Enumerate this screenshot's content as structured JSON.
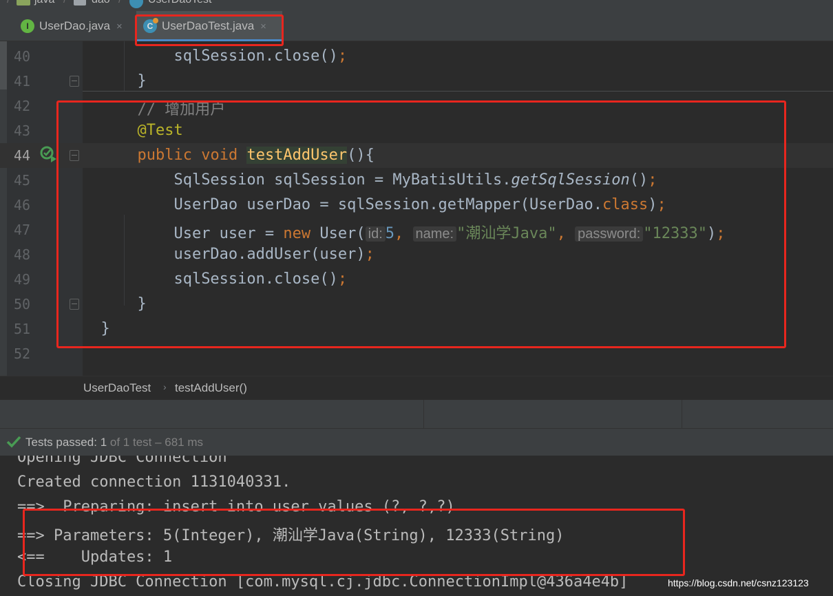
{
  "breadcrumb_top": {
    "items": [
      "java",
      "dao",
      "UserDaoTest"
    ]
  },
  "tabs": [
    {
      "label": "UserDao.java",
      "icon": "interface-icon",
      "active": false
    },
    {
      "label": "UserDaoTest.java",
      "icon": "class-icon",
      "active": true
    }
  ],
  "close_glyph": "×",
  "editor": {
    "line_numbers": [
      "40",
      "41",
      "42",
      "43",
      "44",
      "45",
      "46",
      "47",
      "48",
      "49",
      "50",
      "51",
      "52"
    ],
    "current_line": "44",
    "code": {
      "l40": {
        "text1": "sqlSession.close()",
        "semi": ";"
      },
      "l41": {
        "text": "}"
      },
      "l42": {
        "comment": "// 增加用户"
      },
      "l43": {
        "annotation": "@Test"
      },
      "l44": {
        "kw1": "public",
        "kw2": "void",
        "method": "testAddUser",
        "rest": "(){"
      },
      "l45": {
        "a": "SqlSession sqlSession = MyBatisUtils.",
        "call": "getSqlSession",
        "b": "()",
        "semi": ";"
      },
      "l46": {
        "a": "UserDao userDao = sqlSession.getMapper(UserDao.",
        "kw": "class",
        "b": ")",
        "semi": ";"
      },
      "l47": {
        "a": "User user = ",
        "kw": "new",
        "b": " User(",
        "hint1": "id:",
        "num": "5",
        "c1": ", ",
        "hint2": "name:",
        "str1": "\"潮汕学Java\"",
        "c2": ", ",
        "hint3": "password:",
        "str2": "\"12333\"",
        "d": ")",
        "semi": ";"
      },
      "l48": {
        "a": "userDao.addUser(user)",
        "semi": ";"
      },
      "l49": {
        "a": "sqlSession.close()",
        "semi": ";"
      },
      "l50": {
        "text": "}"
      },
      "l51": {
        "text": "}"
      }
    }
  },
  "editor_breadcrumb": {
    "class_name": "UserDaoTest",
    "method": "testAddUser()",
    "chevron": "›"
  },
  "test_status": {
    "prefix": "Tests passed:",
    "count": "1",
    "suffix": "of 1 test – 681 ms"
  },
  "console_lines": [
    "Opening JDBC Connection",
    "Created connection 1131040331.",
    "==>  Preparing: insert into user values (?, ?,?)",
    "==> Parameters: 5(Integer), 潮汕学Java(String), 12333(String)",
    "<==    Updates: 1",
    "Closing JDBC Connection [com.mysql.cj.jdbc.ConnectionImpl@436a4e4b]"
  ],
  "watermark": "https://blog.csdn.net/csnz123123",
  "colors": {
    "keyword": "#cc7832",
    "string": "#6a8759",
    "number": "#6897bb",
    "annotation": "#bbb529",
    "method": "#ffc66d",
    "annotation_box": "#e8261e",
    "pass_green": "#499c54"
  }
}
